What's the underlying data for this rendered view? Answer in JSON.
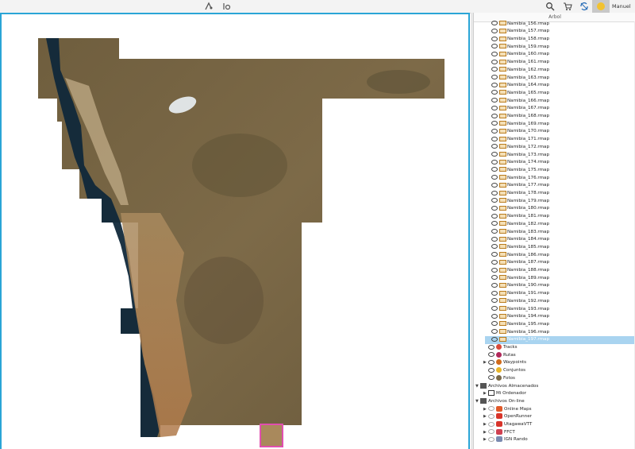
{
  "toolbar": {
    "user_label": "Manuel",
    "icons": [
      "route-tool-icon",
      "map-settings-icon",
      "search-icon",
      "cart-icon",
      "sync-icon",
      "star-icon"
    ]
  },
  "tree": {
    "header": "Arbol",
    "maps": [
      "Namibia_156.rmap",
      "Namibia_157.rmap",
      "Namibia_158.rmap",
      "Namibia_159.rmap",
      "Namibia_160.rmap",
      "Namibia_161.rmap",
      "Namibia_162.rmap",
      "Namibia_163.rmap",
      "Namibia_164.rmap",
      "Namibia_165.rmap",
      "Namibia_166.rmap",
      "Namibia_167.rmap",
      "Namibia_168.rmap",
      "Namibia_169.rmap",
      "Namibia_170.rmap",
      "Namibia_171.rmap",
      "Namibia_172.rmap",
      "Namibia_173.rmap",
      "Namibia_174.rmap",
      "Namibia_175.rmap",
      "Namibia_176.rmap",
      "Namibia_177.rmap",
      "Namibia_178.rmap",
      "Namibia_179.rmap",
      "Namibia_180.rmap",
      "Namibia_181.rmap",
      "Namibia_182.rmap",
      "Namibia_183.rmap",
      "Namibia_184.rmap",
      "Namibia_185.rmap",
      "Namibia_186.rmap",
      "Namibia_187.rmap",
      "Namibia_188.rmap",
      "Namibia_189.rmap",
      "Namibia_190.rmap",
      "Namibia_191.rmap",
      "Namibia_192.rmap",
      "Namibia_193.rmap",
      "Namibia_194.rmap",
      "Namibia_195.rmap",
      "Namibia_196.rmap",
      "Namibia_197.rmap"
    ],
    "selected_index": 41,
    "categories": [
      {
        "label": "Tracks",
        "color": "#d94a3a"
      },
      {
        "label": "Rutas",
        "color": "#b0285a"
      },
      {
        "label": "Waypoints",
        "color": "#d06a1a"
      },
      {
        "label": "Conjuntos",
        "color": "#e8b52a"
      },
      {
        "label": "Fotos",
        "color": "#7a6a4a"
      }
    ],
    "stored": {
      "label": "Archivos Almacenados",
      "children": [
        "Mi Ordenador"
      ]
    },
    "online": {
      "label": "Archivos On-line",
      "children": [
        {
          "label": "Online Maps",
          "color": "#e05a2a"
        },
        {
          "label": "OpenRunner",
          "color": "#d8342a"
        },
        {
          "label": "UtagawaVTT",
          "color": "#d8342a"
        },
        {
          "label": "FFCT",
          "color": "#d04050"
        },
        {
          "label": "IGN Rando",
          "color": "#7a8ab0"
        }
      ]
    }
  },
  "colors": {
    "accent": "#2aa5d6",
    "selection": "#a9d4f0",
    "ocean": "#0f2a3a",
    "desert": "#a0744a",
    "land": "#6e6040",
    "highlight_tile": "#e14fb0"
  }
}
